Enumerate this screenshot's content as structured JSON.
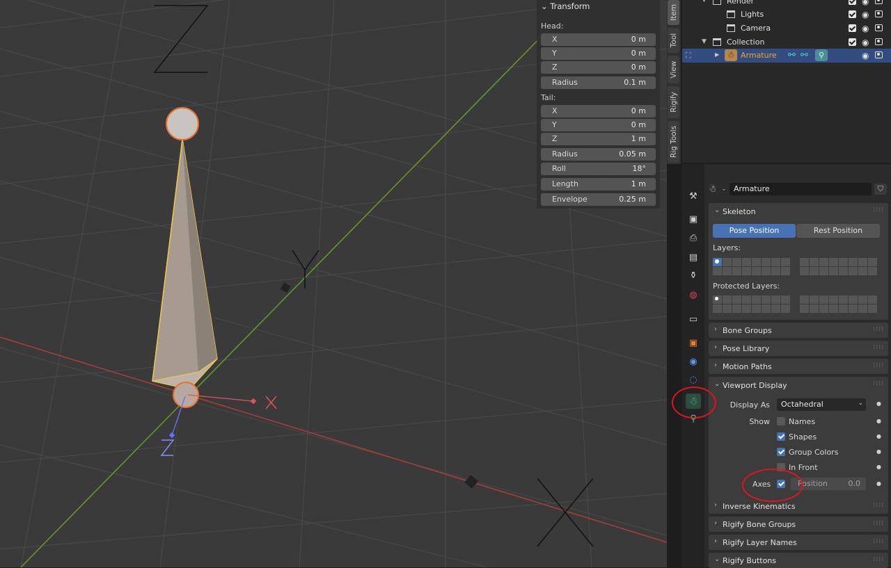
{
  "viewport": {
    "axis_x": "X",
    "axis_y": "Y",
    "axis_z": "Z"
  },
  "npanel": {
    "header": "Transform",
    "head_label": "Head:",
    "tail_label": "Tail:",
    "head": [
      {
        "k": "X",
        "v": "0 m"
      },
      {
        "k": "Y",
        "v": "0 m"
      },
      {
        "k": "Z",
        "v": "0 m"
      },
      {
        "k": "Radius",
        "v": "0.1 m"
      }
    ],
    "tail": [
      {
        "k": "X",
        "v": "0 m"
      },
      {
        "k": "Y",
        "v": "0 m"
      },
      {
        "k": "Z",
        "v": "1 m"
      },
      {
        "k": "Radius",
        "v": "0.05 m"
      },
      {
        "k": "Roll",
        "v": "18°"
      },
      {
        "k": "Length",
        "v": "1 m"
      },
      {
        "k": "Envelope",
        "v": "0.25 m"
      }
    ]
  },
  "vtabs": [
    "Item",
    "Tool",
    "View",
    "Rigify",
    "Rig Tools"
  ],
  "outliner": {
    "rows": [
      {
        "name": "Render"
      },
      {
        "name": "Lights"
      },
      {
        "name": "Camera"
      },
      {
        "name": "Collection"
      },
      {
        "name": "Armature"
      }
    ]
  },
  "properties": {
    "object_name": "Armature",
    "skeleton": {
      "title": "Skeleton",
      "pose_btn": "Pose Position",
      "rest_btn": "Rest Position",
      "layers_label": "Layers:",
      "protected_label": "Protected Layers:"
    },
    "collapsed_panels": [
      "Bone Groups",
      "Pose Library",
      "Motion Paths"
    ],
    "viewport_display": {
      "title": "Viewport Display",
      "display_as_label": "Display As",
      "display_as_value": "Octahedral",
      "show_label": "Show",
      "names": "Names",
      "shapes": "Shapes",
      "group_colors": "Group Colors",
      "in_front": "In Front",
      "axes_label": "Axes",
      "position_label": "Position",
      "position_value": "0.0"
    },
    "bottom_panels": [
      "Inverse Kinematics",
      "Rigify Bone Groups",
      "Rigify Layer Names",
      "Rigify Buttons"
    ]
  },
  "colors": {
    "selection_blue": "#4772b3",
    "armature_orange": "#f5a623",
    "highlight_red": "#e0151b",
    "axis_red": "#c63a3a",
    "axis_green": "#6a9a2a"
  }
}
